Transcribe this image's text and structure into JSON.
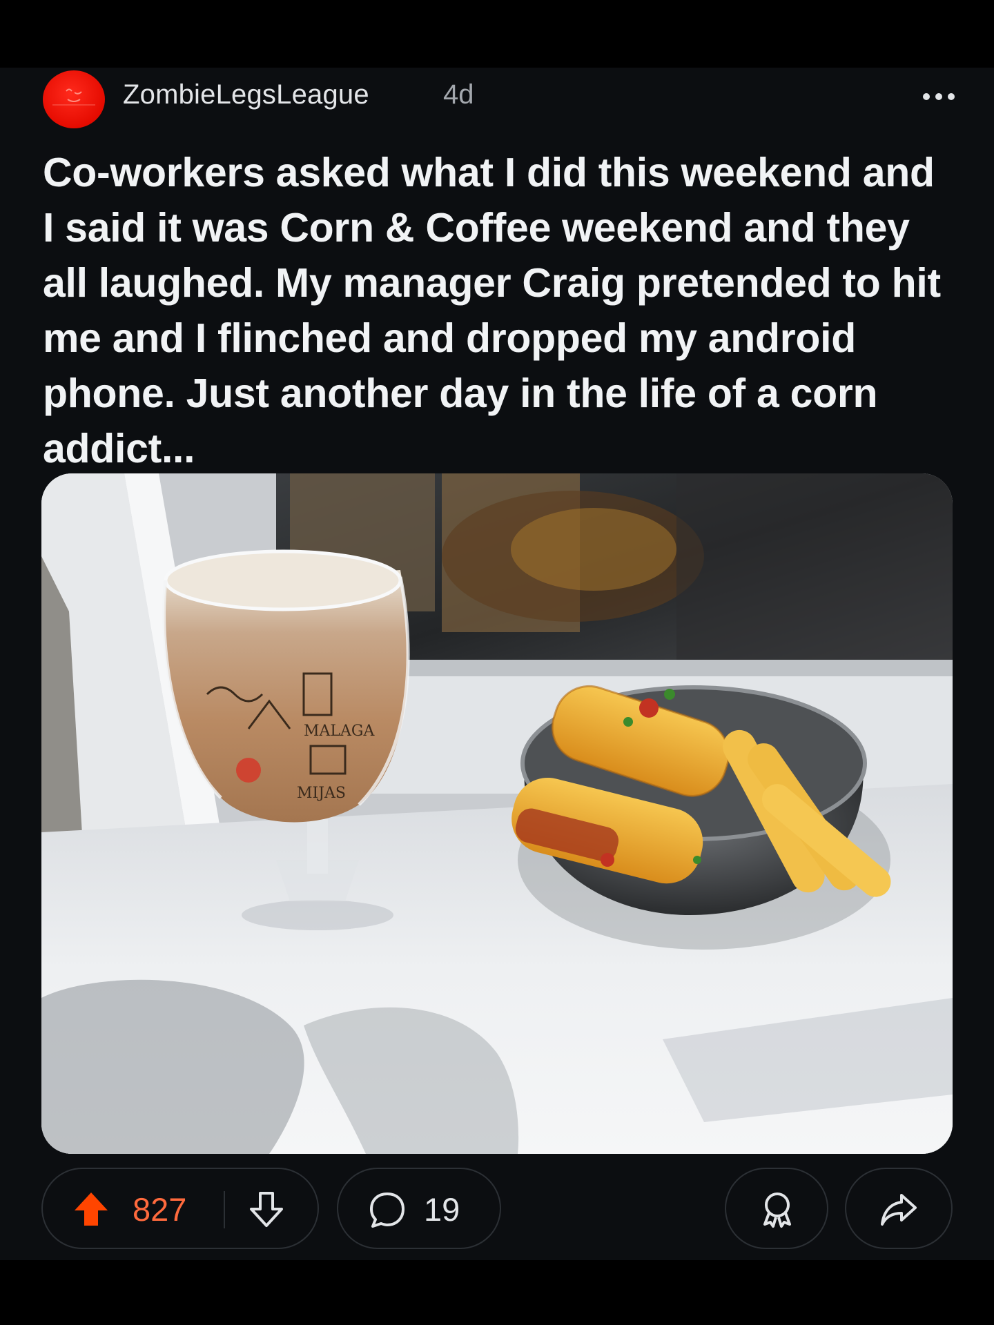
{
  "post": {
    "author": "ZombieLegsLeague",
    "age": "4d",
    "title": "Co-workers asked what I did this weekend and I said it was Corn & Coffee weekend and they all laughed. My manager Craig pretended to hit me and I flinched and dropped my android phone. Just another day in the life of a corn addict...",
    "avatar_color": "#e50b00"
  },
  "photo": {
    "glass_text_top": "MALAGA",
    "glass_text_bottom": "MIJAS"
  },
  "actions": {
    "score": "827",
    "comments": "19",
    "upvote_color": "#ff4500",
    "score_color": "#ff6a3d"
  },
  "icons": {
    "more": "more-horizontal-icon",
    "upvote": "upvote-arrow-icon",
    "downvote": "downvote-arrow-icon",
    "comment": "comment-bubble-icon",
    "award": "award-icon",
    "share": "share-arrow-icon"
  }
}
